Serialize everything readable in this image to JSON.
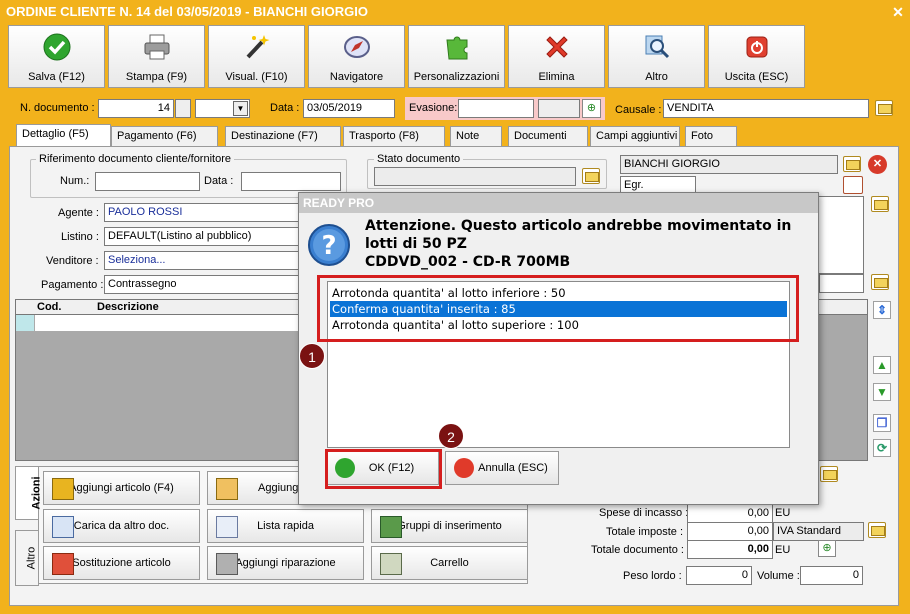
{
  "window": {
    "title": "ORDINE CLIENTE N. 14 del 03/05/2019 - BIANCHI GIORGIO"
  },
  "toolbar": [
    {
      "label": "Salva (F12)",
      "icon": "check-icon"
    },
    {
      "label": "Stampa (F9)",
      "icon": "printer-icon"
    },
    {
      "label": "Visual. (F10)",
      "icon": "magic-wand-icon"
    },
    {
      "label": "Navigatore",
      "icon": "compass-icon"
    },
    {
      "label": "Personalizzazioni",
      "icon": "puzzle-icon"
    },
    {
      "label": "Elimina",
      "icon": "delete-x-icon"
    },
    {
      "label": "Altro",
      "icon": "magnifier-icon"
    },
    {
      "label": "Uscita (ESC)",
      "icon": "power-icon"
    }
  ],
  "header": {
    "ndoc_label": "N. documento :",
    "ndoc_value": "14",
    "data_label": "Data :",
    "data_value": "03/05/2019",
    "evasione_label": "Evasione:",
    "causale_label": "Causale :",
    "causale_value": "VENDITA"
  },
  "tabs": [
    "Dettaglio (F5)",
    "Pagamento (F6)",
    "Destinazione (F7)",
    "Trasporto (F8)",
    "Note",
    "Documenti",
    "Campi aggiuntivi",
    "Foto"
  ],
  "detail": {
    "rif_label": "Riferimento documento cliente/fornitore",
    "num_label": "Num.:",
    "data_label": "Data :",
    "stato_label": "Stato documento",
    "cliente_name": "BIANCHI GIORGIO",
    "cliente_title": "Egr.",
    "agente_label": "Agente :",
    "agente_value": "PAOLO ROSSI",
    "listino_label": "Listino :",
    "listino_value": "DEFAULT(Listino al pubblico)",
    "venditore_label": "Venditore :",
    "venditore_value": "Seleziona...",
    "pagamento_label": "Pagamento :",
    "pagamento_value": "Contrassegno"
  },
  "grid": {
    "col_cod": "Cod.",
    "col_desc": "Descrizione"
  },
  "actions": {
    "vtab_azioni": "Azioni",
    "vtab_altro": "Altro",
    "buttons": [
      "Aggiungi articolo (F4)",
      "Aggiungi",
      "Carica da altro doc.",
      "Lista rapida",
      "Gruppi di inserimento",
      "Sostituzione articolo",
      "Aggiungi riparazione",
      "Carrello"
    ]
  },
  "totals": {
    "spese_label": "Spese di incasso :",
    "spese_value": "0,00",
    "spese_cur": "EU",
    "imposte_label": "Totale imposte :",
    "imposte_value": "0,00",
    "imposte_desc": "IVA Standard",
    "totdoc_label": "Totale documento :",
    "totdoc_value": "0,00",
    "totdoc_cur": "EU",
    "peso_label": "Peso lordo :",
    "peso_value": "0",
    "volume_label": "Volume :",
    "volume_value": "0"
  },
  "dialog": {
    "title": "READY PRO",
    "message_line1": "Attenzione. Questo articolo andrebbe movimentato in",
    "message_line2": "lotti di 50 PZ",
    "message_line3": "CDDVD_002 - CD-R 700MB",
    "options": [
      "Arrotonda quantita' al lotto inferiore : 50",
      "Conferma quantita' inserita : 85",
      "Arrotonda quantita' al lotto superiore : 100"
    ],
    "selected_index": 1,
    "ok_label": "OK (F12)",
    "cancel_label": "Annulla (ESC)",
    "badge1": "1",
    "badge2": "2"
  },
  "colors": {
    "accent": "#f2b21c",
    "selection": "#0a73d6",
    "highlight": "#d51e1e",
    "badge": "#7a1212"
  }
}
